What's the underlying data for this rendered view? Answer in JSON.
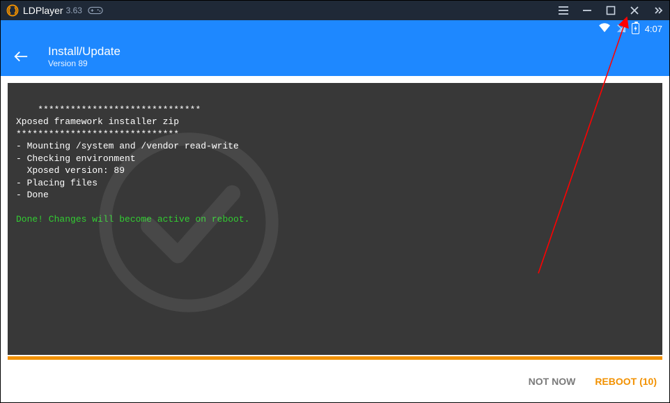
{
  "titlebar": {
    "app_name": "LDPlayer",
    "app_version": "3.63"
  },
  "statusbar": {
    "time": "4:07"
  },
  "appbar": {
    "title": "Install/Update",
    "subtitle": "Version 89"
  },
  "console": {
    "lines": [
      "******************************",
      "Xposed framework installer zip",
      "******************************",
      "- Mounting /system and /vendor read-write",
      "- Checking environment",
      "  Xposed version: 89",
      "- Placing files",
      "- Done"
    ],
    "success_line": "Done! Changes will become active on reboot."
  },
  "progress": {
    "percent": 100
  },
  "actions": {
    "not_now": "NOT NOW",
    "reboot": "REBOOT (10)"
  }
}
